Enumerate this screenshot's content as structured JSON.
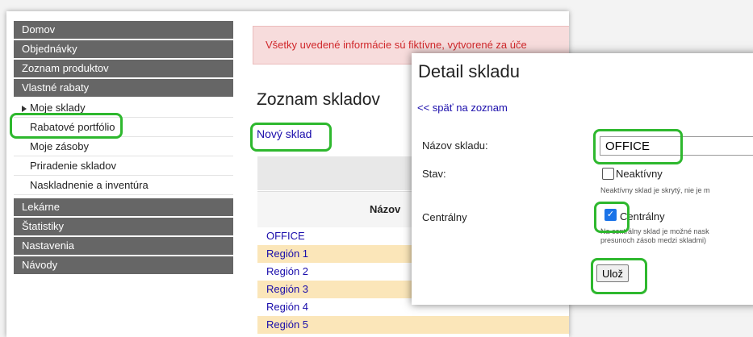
{
  "sidebar": {
    "items": [
      {
        "label": "Domov"
      },
      {
        "label": "Objednávky"
      },
      {
        "label": "Zoznam produktov"
      },
      {
        "label": "Vlastné rabaty"
      }
    ],
    "sub_items": [
      {
        "label": "Moje sklady"
      },
      {
        "label": "Rabatové portfólio"
      },
      {
        "label": "Moje zásoby"
      },
      {
        "label": "Priradenie skladov"
      },
      {
        "label": "Naskladnenie a inventúra"
      }
    ],
    "bottom_items": [
      {
        "label": "Lekárne"
      },
      {
        "label": "Štatistiky"
      },
      {
        "label": "Nastavenia"
      },
      {
        "label": "Návody"
      }
    ]
  },
  "alert": {
    "text": "Všetky uvedené informácie sú fiktívne, vytvorené za úče"
  },
  "list": {
    "title": "Zoznam skladov",
    "new_link": "Nový sklad",
    "column_header": "Názov",
    "rows": [
      "OFFICE",
      "Región 1",
      "Región 2",
      "Región 3",
      "Región 4",
      "Región 5"
    ]
  },
  "dialog": {
    "title": "Detail skladu",
    "back_link": "<< späť na zoznam",
    "name_label": "Názov skladu:",
    "name_value": "OFFICE",
    "status_label": "Stav:",
    "inactive_label": "Neaktívny",
    "inactive_checked": false,
    "inactive_hint": "Neaktívny sklad je skrytý, nie je m",
    "central_label": "Centrálny",
    "central_checkbox_label": "Centrálny",
    "central_checked": true,
    "central_hint_1": "Na centrálny sklad je možné nask",
    "central_hint_2": "presunoch zásob medzi skladmi)",
    "save_button": "Ulož"
  },
  "colors": {
    "sidebar_bg": "#666666",
    "highlight": "#2eb82e",
    "link": "#1a0dab",
    "alert_text": "#d0282b",
    "row_alt": "#fbe6b9"
  }
}
